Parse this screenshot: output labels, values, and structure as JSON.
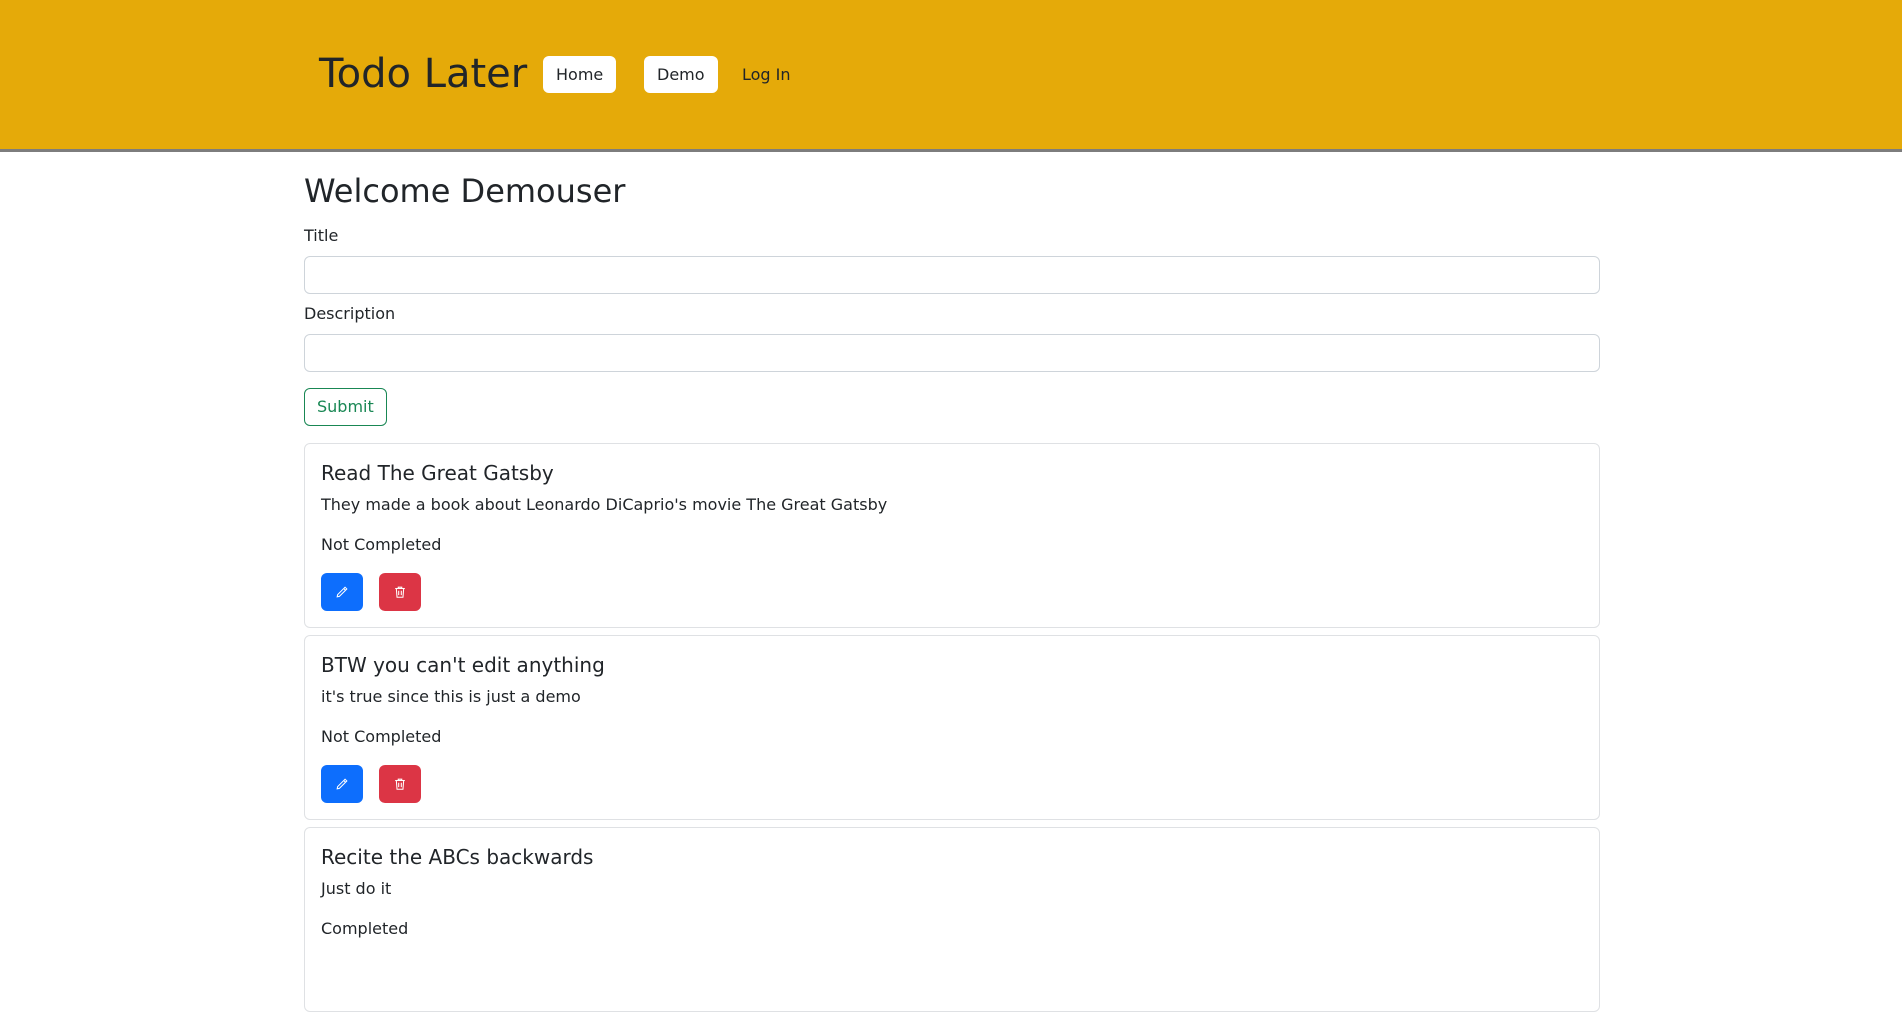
{
  "navbar": {
    "brand": "Todo Later",
    "links": [
      {
        "label": "Home"
      },
      {
        "label": "Demo"
      },
      {
        "label": "Log In"
      }
    ]
  },
  "main": {
    "welcome": "Welcome Demouser",
    "form": {
      "title_label": "Title",
      "title_value": "",
      "description_label": "Description",
      "description_value": "",
      "submit_label": "Submit"
    },
    "todos": [
      {
        "title": "Read The Great Gatsby",
        "description": "They made a book about Leonardo DiCaprio's movie The Great Gatsby",
        "status": "Not Completed"
      },
      {
        "title": "BTW you can't edit anything",
        "description": "it's true since this is just a demo",
        "status": "Not Completed"
      },
      {
        "title": "Recite the ABCs backwards",
        "description": "Just do it",
        "status": "Completed"
      }
    ]
  },
  "icons": {
    "edit": "pencil-icon",
    "delete": "trash-icon"
  },
  "colors": {
    "navbar_bg": "#e5aa09",
    "edit_button": "#0d6efd",
    "delete_button": "#dc3545",
    "submit_outline": "#198754"
  }
}
